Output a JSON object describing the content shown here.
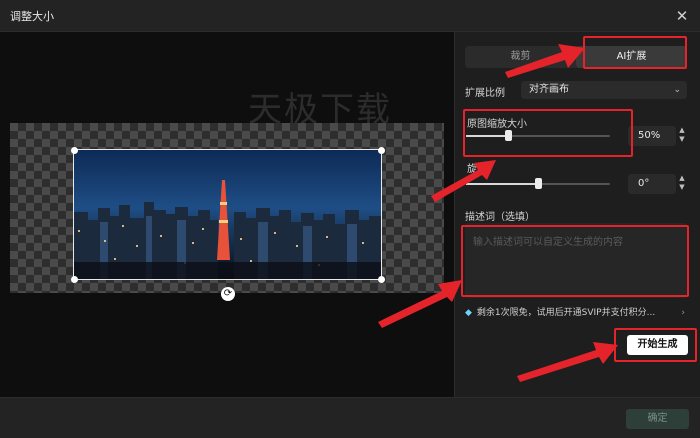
{
  "window": {
    "title": "调整大小",
    "close_icon": "close-icon"
  },
  "preview": {
    "watermark": "天极下载"
  },
  "tabs": [
    {
      "label": "裁剪",
      "active": false
    },
    {
      "label": "AI扩展",
      "active": true
    }
  ],
  "extend_ratio": {
    "label": "扩展比例",
    "value": "对齐画布"
  },
  "scale": {
    "label": "原图缩放大小",
    "value": "50%",
    "level": 0.28
  },
  "rotate": {
    "label": "旋转",
    "value": "0°",
    "level": 0.5
  },
  "description": {
    "label": "描述词（选填）",
    "placeholder": "输入描述词可以自定义生成的内容"
  },
  "notice": {
    "text": "剩余1次限免，试用后开通SVIP并支付积分..."
  },
  "buttons": {
    "generate": "开始生成",
    "confirm": "确定"
  },
  "colors": {
    "annotation_red": "#e4232b",
    "accent_diamond": "#6fd3ff"
  }
}
